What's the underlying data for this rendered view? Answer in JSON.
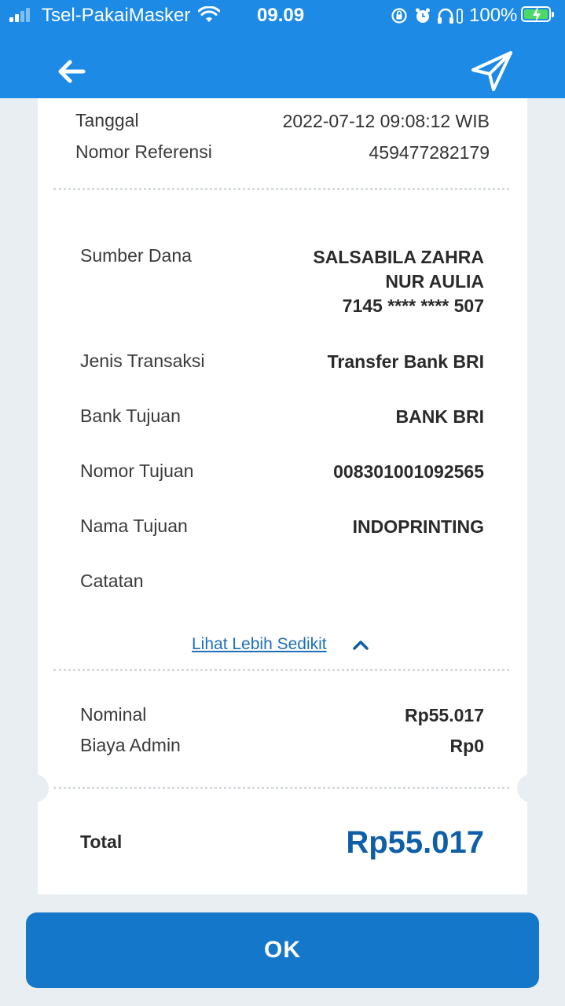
{
  "status_bar": {
    "carrier": "Tsel-PakaiMasker",
    "time": "09.09",
    "battery": "100%"
  },
  "header": {
    "back_icon": "arrow-left-icon",
    "share_icon": "send-icon"
  },
  "receipt": {
    "date_label": "Tanggal",
    "date_value": "2022-07-12 09:08:12 WIB",
    "ref_label": "Nomor Referensi",
    "ref_value": "459477282179",
    "details": {
      "source_label": "Sumber Dana",
      "source_name_line1": "SALSABILA ZAHRA",
      "source_name_line2": "NUR AULIA",
      "source_account": "7145 **** **** 507",
      "type_label": "Jenis Transaksi",
      "type_value": "Transfer Bank BRI",
      "bank_label": "Bank Tujuan",
      "bank_value": "BANK BRI",
      "dest_number_label": "Nomor Tujuan",
      "dest_number_value": "008301001092565",
      "dest_name_label": "Nama Tujuan",
      "dest_name_value": "INDOPRINTING",
      "note_label": "Catatan",
      "note_value": ""
    },
    "toggle_label": "Lihat Lebih Sedikit",
    "nominal_label": "Nominal",
    "nominal_value": "Rp55.017",
    "admin_label": "Biaya Admin",
    "admin_value": "Rp0",
    "total_label": "Total",
    "total_value": "Rp55.017"
  },
  "ok_button": "OK",
  "colors": {
    "header_bg": "#1d8ae6",
    "button_bg": "#1477c9",
    "total_text": "#0f5ea8",
    "link_text": "#1d6fb8",
    "page_bg": "#e9eef2"
  }
}
